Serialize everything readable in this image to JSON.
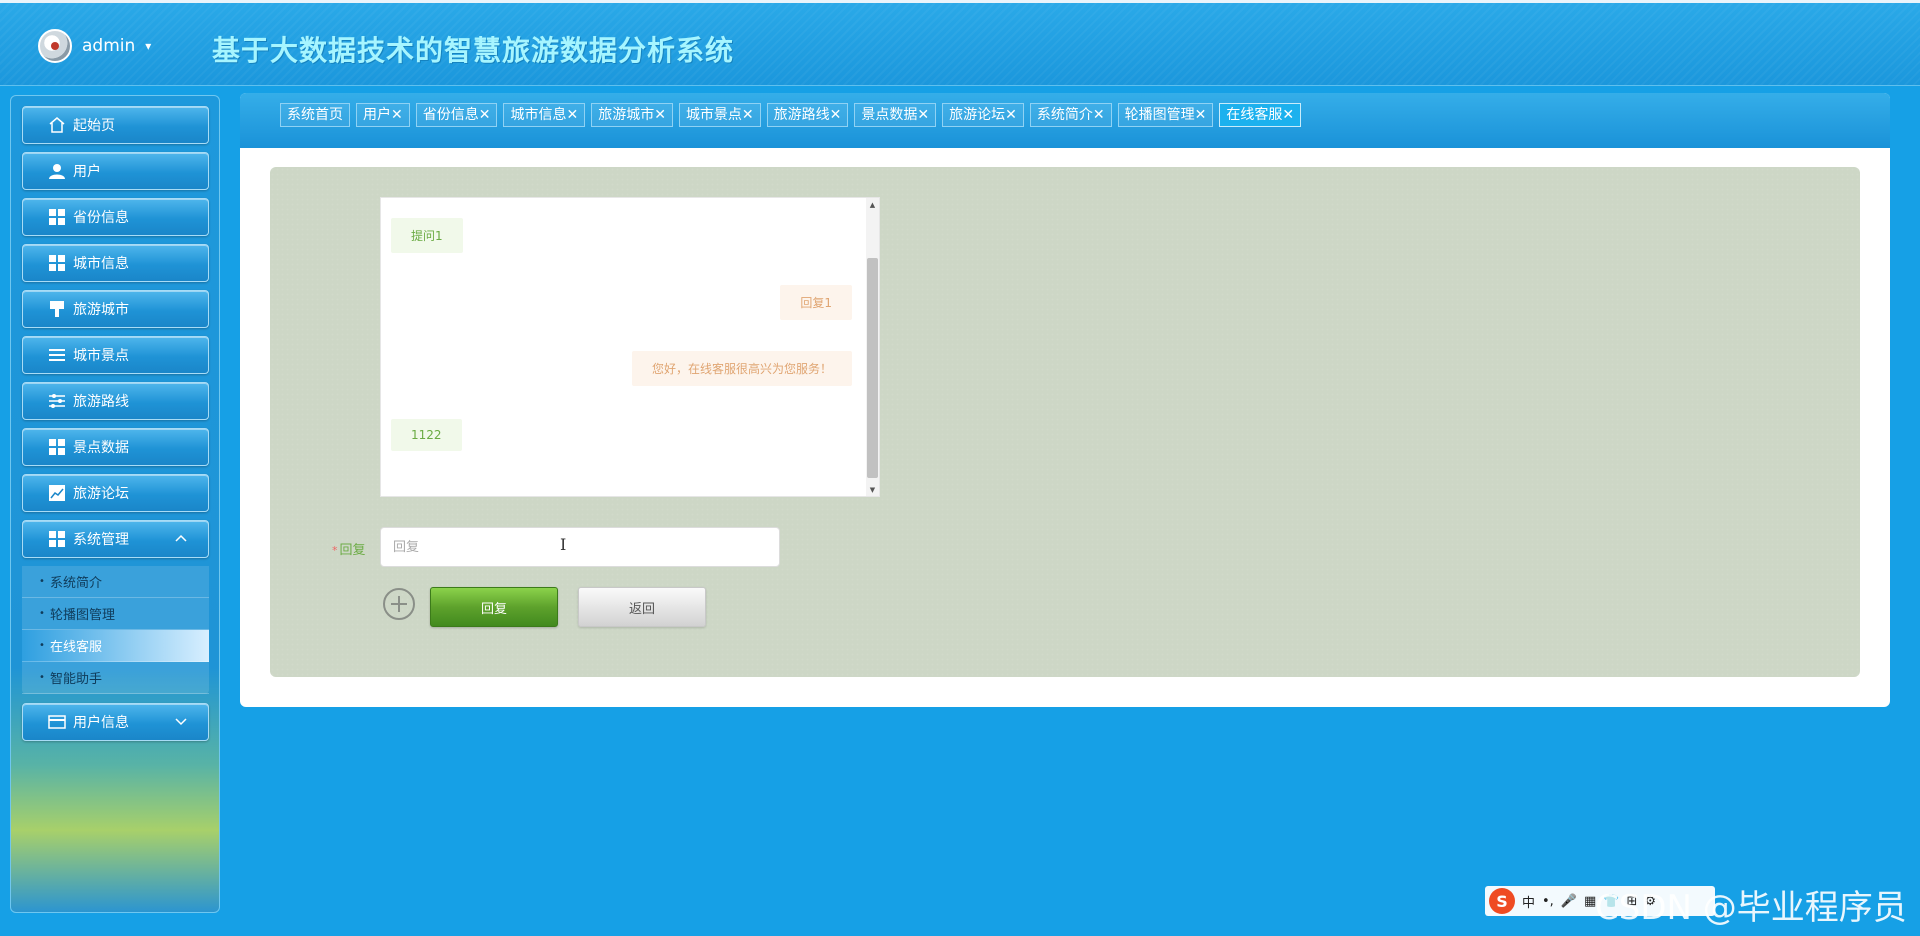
{
  "header": {
    "user_name": "admin",
    "caret": "▾",
    "title": "基于大数据技术的智慧旅游数据分析系统"
  },
  "sidebar": {
    "items": [
      {
        "label": "起始页",
        "icon": "home-icon"
      },
      {
        "label": "用户",
        "icon": "user-icon"
      },
      {
        "label": "省份信息",
        "icon": "grid-icon"
      },
      {
        "label": "城市信息",
        "icon": "grid-icon"
      },
      {
        "label": "旅游城市",
        "icon": "flag-icon"
      },
      {
        "label": "城市景点",
        "icon": "list-icon"
      },
      {
        "label": "旅游路线",
        "icon": "sliders-icon"
      },
      {
        "label": "景点数据",
        "icon": "grid-icon"
      },
      {
        "label": "旅游论坛",
        "icon": "chart-icon"
      },
      {
        "label": "系统管理",
        "icon": "grid-icon",
        "expanded": true
      },
      {
        "label": "用户信息",
        "icon": "card-icon",
        "expanded": false
      }
    ],
    "submenu": [
      {
        "label": "系统简介"
      },
      {
        "label": "轮播图管理"
      },
      {
        "label": "在线客服",
        "active": true
      },
      {
        "label": "智能助手"
      }
    ]
  },
  "tabs": [
    {
      "label": "系统首页"
    },
    {
      "label": "用户✕"
    },
    {
      "label": "省份信息✕"
    },
    {
      "label": "城市信息✕"
    },
    {
      "label": "旅游城市✕"
    },
    {
      "label": "城市景点✕"
    },
    {
      "label": "旅游路线✕"
    },
    {
      "label": "景点数据✕"
    },
    {
      "label": "旅游论坛✕"
    },
    {
      "label": "系统简介✕"
    },
    {
      "label": "轮播图管理✕"
    },
    {
      "label": "在线客服✕",
      "active": true
    }
  ],
  "chat": {
    "messages": [
      {
        "text": "提问1",
        "side": "left"
      },
      {
        "text": "回复1",
        "side": "right"
      },
      {
        "text": "您好，在线客服很高兴为您服务！",
        "side": "right"
      },
      {
        "text": "1122",
        "side": "left"
      }
    ]
  },
  "form": {
    "required_mark": "*",
    "reply_label": "回复",
    "reply_placeholder": "回复",
    "reply_button": "回复",
    "back_button": "返回"
  },
  "ime": {
    "logo": "S",
    "mode": "中",
    "symbols": "•,",
    "items": [
      "🎤",
      "▦",
      "👕",
      "⊞",
      "⚙"
    ]
  },
  "watermark": "CSDN @毕业程序员",
  "colors": {
    "page_bg": "#16a0e6",
    "title_color": "#a6f5ff",
    "content_bg": "#cdd7c6",
    "reply_button": "#5ea22c",
    "msg_left_text": "#6bab44",
    "msg_right_text": "#e0a572"
  }
}
